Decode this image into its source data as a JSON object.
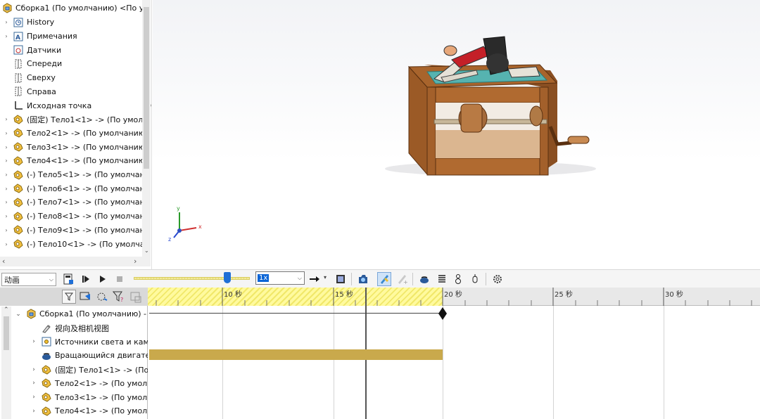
{
  "tree": {
    "header": "Сборка1 (По умолчанию) <По ум",
    "items": [
      {
        "label": "History",
        "icon": "history-icon",
        "arrow": true
      },
      {
        "label": "Примечания",
        "icon": "annotations-icon",
        "arrow": true
      },
      {
        "label": "Датчики",
        "icon": "sensors-icon",
        "arrow": false
      },
      {
        "label": "Спереди",
        "icon": "plane-icon",
        "arrow": false
      },
      {
        "label": "Сверху",
        "icon": "plane-icon",
        "arrow": false
      },
      {
        "label": "Справа",
        "icon": "plane-icon",
        "arrow": false
      },
      {
        "label": "Исходная точка",
        "icon": "origin-icon",
        "arrow": false
      },
      {
        "label": "(固定) Тело1<1> -> (По умолч",
        "icon": "part-icon",
        "arrow": true
      },
      {
        "label": "Тело2<1> -> (По умолчанию",
        "icon": "part-icon",
        "arrow": true
      },
      {
        "label": "Тело3<1> -> (По умолчанию",
        "icon": "part-icon",
        "arrow": true
      },
      {
        "label": "Тело4<1> -> (По умолчанию",
        "icon": "part-icon",
        "arrow": true
      },
      {
        "label": "(-) Тело5<1> -> (По умолчан",
        "icon": "part-icon",
        "arrow": true
      },
      {
        "label": "(-) Тело6<1> -> (По умолчан",
        "icon": "part-icon",
        "arrow": true
      },
      {
        "label": "(-) Тело7<1> -> (По умолчан",
        "icon": "part-icon",
        "arrow": true
      },
      {
        "label": "(-) Тело8<1> -> (По умолчан",
        "icon": "part-icon",
        "arrow": true
      },
      {
        "label": "(-) Тело9<1> -> (По умолчан",
        "icon": "part-icon",
        "arrow": true
      },
      {
        "label": "(-) Тело10<1> -> (По умолча",
        "icon": "part-icon",
        "arrow": true
      }
    ]
  },
  "toolbar": {
    "study_type": "动画",
    "speed": "1x"
  },
  "ruler": {
    "labels": [
      "10 秒",
      "15 秒",
      "20 秒",
      "25 秒",
      "30 秒"
    ]
  },
  "timeline_tree": {
    "items": [
      {
        "label": "Сборка1 (По умолчанию) -",
        "icon": "assembly-icon",
        "arrow": "down"
      },
      {
        "label": "视向及相机视图",
        "icon": "camera-icon",
        "arrow": ""
      },
      {
        "label": "Источники света и кам",
        "icon": "lights-icon",
        "arrow": "right"
      },
      {
        "label": "Вращающийся двигате",
        "icon": "motor-icon",
        "arrow": ""
      },
      {
        "label": "(固定) Тело1<1> -> (По",
        "icon": "part-icon",
        "arrow": "right"
      },
      {
        "label": "Тело2<1> -> (По умолч",
        "icon": "part-icon",
        "arrow": "right"
      },
      {
        "label": "Тело3<1> -> (По умолч",
        "icon": "part-icon",
        "arrow": "right"
      },
      {
        "label": "Тело4<1> -> (По умолч",
        "icon": "part-icon",
        "arrow": "right"
      }
    ]
  },
  "axes": {
    "x": "x",
    "y": "y",
    "z": "z"
  },
  "colors": {
    "accent": "#1f6fd6",
    "timebar": "#c9a94c",
    "ruler_yellow": "#f1e86a"
  }
}
